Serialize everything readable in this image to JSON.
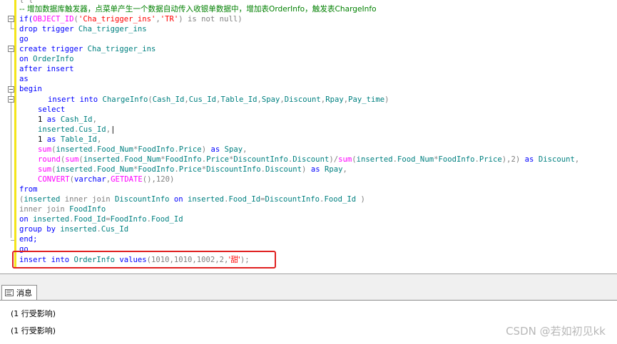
{
  "editor": {
    "top_fragment": "{ {",
    "comment": "-- 增加数据库触发器，点菜单产生一个数据自动传入收银单数据中，增加表OrderInfo，触发表ChargeInfo",
    "line_if": [
      "if(",
      "OBJECT_ID",
      "(",
      "'Cha_trigger_ins'",
      ",",
      "'TR'",
      ") is not null)"
    ],
    "line_drop": [
      "drop trigger ",
      "Cha_trigger_ins"
    ],
    "line_go1": "go",
    "line_create": [
      "create trigger ",
      "Cha_trigger_ins"
    ],
    "line_on": [
      "on ",
      "OrderInfo"
    ],
    "line_after": "after insert",
    "line_as": "as",
    "line_begin": "begin",
    "line_insert_charge": [
      "insert into ",
      "ChargeInfo",
      "(",
      "Cash_Id",
      ",",
      "Cus_Id",
      ",",
      "Table_Id",
      ",",
      "Spay",
      ",",
      "Discount",
      ",",
      "Rpay",
      ",",
      "Pay_time",
      ")"
    ],
    "line_select": "select",
    "line_cash": [
      "1 ",
      "as ",
      "Cash_Id",
      ","
    ],
    "line_cus": [
      "inserted",
      ".",
      "Cus_Id",
      ","
    ],
    "line_table": [
      "1 ",
      "as ",
      "Table_Id",
      ","
    ],
    "line_spay": [
      "sum",
      "(",
      "inserted",
      ".",
      "Food_Num",
      "*",
      "FoodInfo",
      ".",
      "Price",
      ") ",
      "as ",
      "Spay",
      ","
    ],
    "line_discount": [
      "round",
      "(",
      "sum",
      "(",
      "inserted",
      ".",
      "Food_Num",
      "*",
      "FoodInfo",
      ".",
      "Price",
      "*",
      "DiscountInfo",
      ".",
      "Discount",
      ")/",
      "sum",
      "(",
      "inserted",
      ".",
      "Food_Num",
      "*",
      "FoodInfo",
      ".",
      "Price",
      "),2) ",
      "as ",
      "Discount",
      ","
    ],
    "line_rpay": [
      "sum",
      "(",
      "inserted",
      ".",
      "Food_Num",
      "*",
      "FoodInfo",
      ".",
      "Price",
      "*",
      "DiscountInfo",
      ".",
      "Discount",
      ") ",
      "as ",
      "Rpay",
      ","
    ],
    "line_convert": [
      "CONVERT",
      "(",
      "varchar",
      ",",
      "GETDATE",
      "(),120)"
    ],
    "line_from": "from",
    "line_join1": [
      "(",
      "inserted ",
      "inner join ",
      "DiscountInfo ",
      "on ",
      "inserted",
      ".",
      "Food_Id",
      "=",
      "DiscountInfo",
      ".",
      "Food_Id",
      " )"
    ],
    "line_join2": [
      "inner join ",
      "FoodInfo"
    ],
    "line_on2": [
      "on ",
      "inserted",
      ".",
      "Food_Id",
      "=",
      "FoodInfo",
      ".",
      "Food_Id"
    ],
    "line_group": [
      "group by ",
      "inserted",
      ".",
      "Cus_Id"
    ],
    "line_end": "end;",
    "line_go2": "go",
    "line_insert_order": [
      "insert into ",
      "OrderInfo ",
      "values",
      "(1010,1010,1002,2,",
      "'甜'",
      ");"
    ]
  },
  "messages_tab": {
    "label": "消息",
    "icon": "messages-icon"
  },
  "messages": [
    "(1 行受影响)",
    "(1 行受影响)"
  ],
  "watermark": "CSDN @若如初见kk",
  "colors": {
    "keyword": "#0000ff",
    "function": "#ff00ff",
    "string": "#ff0000",
    "comment": "#008000",
    "operator": "#808080",
    "highlight_border": "#e02020",
    "change_bar": "#f4e51a"
  }
}
